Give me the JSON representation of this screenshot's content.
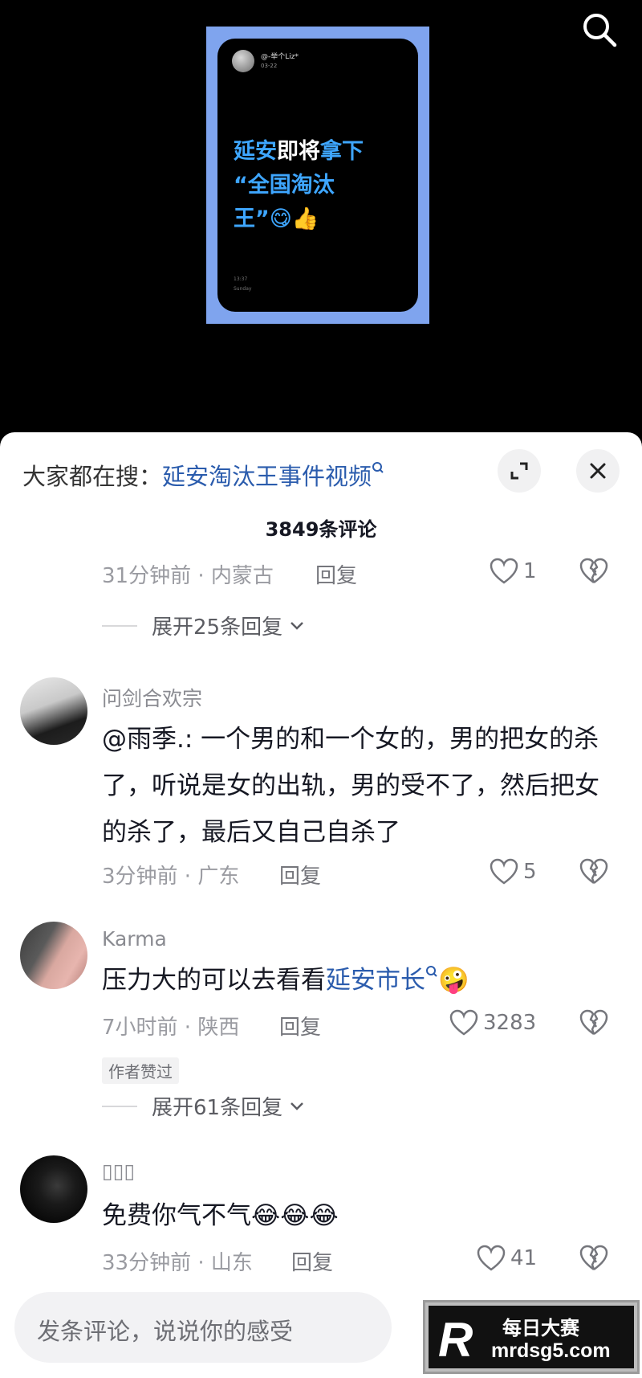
{
  "video": {
    "post_user": "@-举个Liz*",
    "post_date": "03-22",
    "headline_blue_1": "延安",
    "headline_white_1": "即将",
    "headline_blue_2": "拿下",
    "headline_line_2": "“全国淘汰",
    "headline_line_3": "王”😋👍",
    "phone_time": "13:37",
    "phone_day": "Sunday"
  },
  "panel": {
    "trending_prefix": "大家都在搜：",
    "trending_query": "延安淘汰王事件视频",
    "comment_count": "3849条评论"
  },
  "partial": {
    "meta": "31分钟前 · 内蒙古",
    "reply_label": "回复",
    "likes": "1"
  },
  "expand_1": "展开25条回复",
  "comments": [
    {
      "username": "问剑合欢宗",
      "text": "@雨季.: 一个男的和一个女的，男的把女的杀了，听说是女的出轨，男的受不了，然后把女的杀了，最后又自己自杀了",
      "meta": "3分钟前 · 广东",
      "reply_label": "回复",
      "likes": "5"
    },
    {
      "username": "Karma",
      "text_prefix": "压力大的可以去看看",
      "text_link": "延安市长",
      "text_suffix": "🤪",
      "meta": "7小时前 · 陕西",
      "reply_label": "回复",
      "likes": "3283",
      "badge": "作者赞过"
    },
    {
      "username": "▯▯▯",
      "text": "免费你气不气😂😂😂",
      "meta": "33分钟前 · 山东",
      "reply_label": "回复",
      "likes": "41"
    }
  ],
  "expand_2": "展开61条回复",
  "input": {
    "placeholder": "发条评论，说说你的感受"
  },
  "watermark": {
    "letter": "R",
    "cn": "每日大赛",
    "en": "mrdsg5.com"
  },
  "colors": {
    "link": "#2b5cad",
    "panel_bg": "#ffffff",
    "frame": "#7fa4ee",
    "highlight": "#3ea6ff"
  },
  "icons": [
    "search-icon",
    "expand-icon",
    "close-icon",
    "heart-icon",
    "broken-heart-icon",
    "chevron-down-icon",
    "search-small-icon"
  ]
}
